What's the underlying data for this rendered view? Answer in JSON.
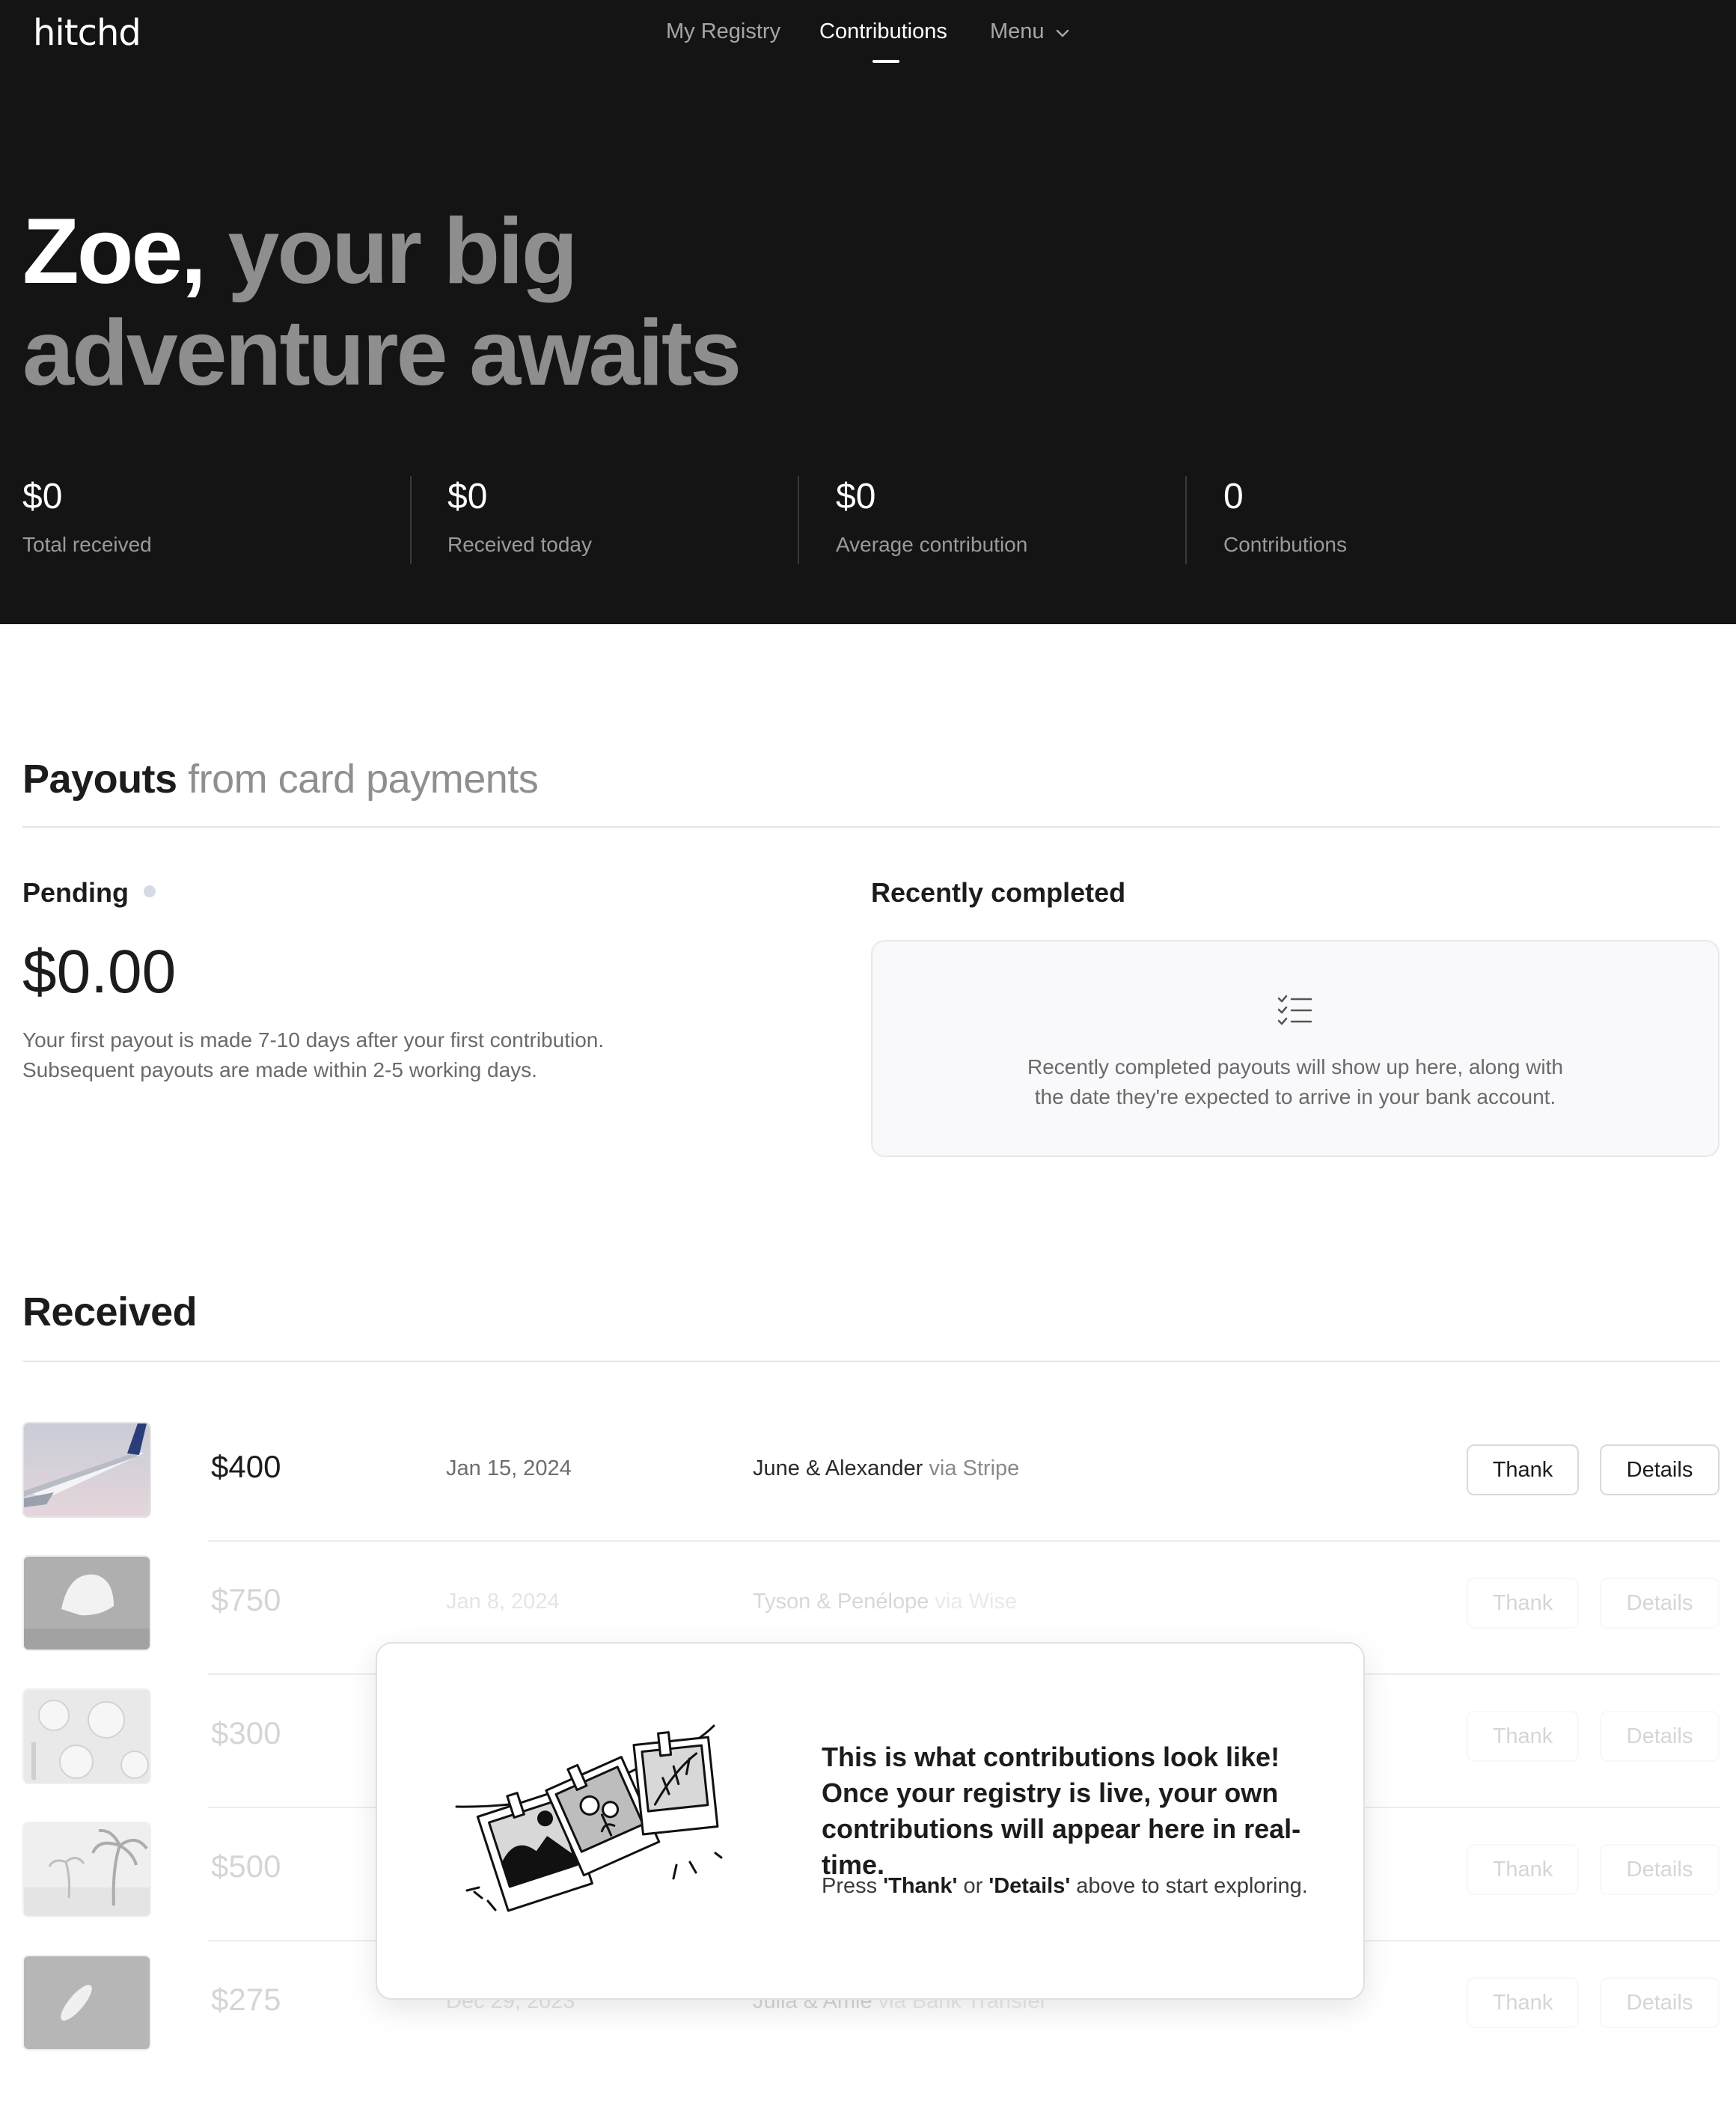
{
  "header": {
    "logo": "hitchd",
    "nav": {
      "my_registry": "My Registry",
      "contributions": "Contributions",
      "menu": "Menu"
    }
  },
  "hero": {
    "name": "Zoe,",
    "headline_line1_rest": "your big",
    "headline_line2": "adventure awaits"
  },
  "stats": [
    {
      "value": "$0",
      "label": "Total received"
    },
    {
      "value": "$0",
      "label": "Received today"
    },
    {
      "value": "$0",
      "label": "Average contribution"
    },
    {
      "value": "0",
      "label": "Contributions"
    }
  ],
  "payouts": {
    "title": "Payouts",
    "title_suffix": "from card payments",
    "pending_label": "Pending",
    "pending_amount": "$0.00",
    "pending_text_1": "Your first payout is made 7-10 days after your first contribution.",
    "pending_text_2": "Subsequent payouts are made within 2-5 working days.",
    "recent_label": "Recently completed",
    "recent_empty_1": "Recently completed payouts will show up here, along with",
    "recent_empty_2": "the date they're expected to arrive in your bank account."
  },
  "received": {
    "title": "Received",
    "rows": [
      {
        "amount": "$400",
        "date": "Jan 15, 2024",
        "from": "June & Alexander",
        "via": "via Stripe",
        "thank": "Thank",
        "details": "Details"
      },
      {
        "amount": "$750",
        "date": "Jan 8, 2024",
        "from": "Tyson & Penélope",
        "via": "via Wise",
        "thank": "Thank",
        "details": "Details"
      },
      {
        "amount": "$300",
        "date": "",
        "from": "",
        "via": "",
        "thank": "Thank",
        "details": "Details"
      },
      {
        "amount": "$500",
        "date": "",
        "from": "",
        "via": "",
        "thank": "Thank",
        "details": "Details"
      },
      {
        "amount": "$275",
        "date": "Dec 29, 2023",
        "from": "Julia & Amie",
        "via": "via Bank Transfer",
        "thank": "Thank",
        "details": "Details"
      }
    ]
  },
  "modal": {
    "heading": "This is what contributions look like! Once your registry is live, your own contributions will appear here in real-time.",
    "press": "Press",
    "thank_q": "'Thank'",
    "or": "or",
    "details_q": "'Details'",
    "rest": "above to start exploring."
  },
  "colors": {
    "hero_bg": "#141414",
    "muted_text": "#8e8e8e",
    "panel_bg": "#f9f9fb",
    "pending_dot": "#d6dae6"
  }
}
